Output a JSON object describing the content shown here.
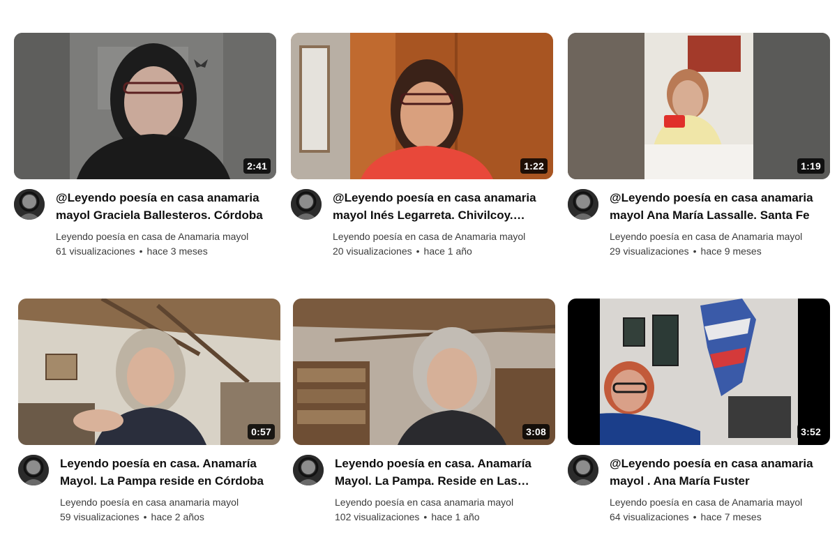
{
  "videos": [
    {
      "duration": "2:41",
      "title": "@Leyendo poesía en casa anamaria mayol Graciela Ballesteros. Córdoba",
      "channel": "Leyendo poesía en casa de Anamaria mayol",
      "views": "61 visualizaciones",
      "age": "hace 3 meses"
    },
    {
      "duration": "1:22",
      "title": "@Leyendo poesía en casa anamaria mayol Inés Legarreta. Chivilcoy. Buenos Aires",
      "channel": "Leyendo poesía en casa de Anamaria mayol",
      "views": "20 visualizaciones",
      "age": "hace 1 año"
    },
    {
      "duration": "1:19",
      "title": "@Leyendo poesía en casa anamaria mayol Ana María Lassalle. Santa Fe",
      "channel": "Leyendo poesía en casa de Anamaria mayol",
      "views": "29 visualizaciones",
      "age": "hace 9 meses"
    },
    {
      "duration": "0:57",
      "title": "Leyendo poesía en casa. Anamaría Mayol. La Pampa reside en Córdoba",
      "channel": "Leyendo poesía en casa anamaria mayol",
      "views": "59 visualizaciones",
      "age": "hace 2 años"
    },
    {
      "duration": "3:08",
      "title": "Leyendo poesía en casa. Anamaría Mayol. La Pampa. Reside en Las Sierras",
      "channel": "Leyendo poesía en casa anamaria mayol",
      "views": "102 visualizaciones",
      "age": "hace 1 año"
    },
    {
      "duration": "3:52",
      "title": "@Leyendo poesía en casa anamaria mayol . Ana María Fuster",
      "channel": "Leyendo poesía en casa de Anamaria mayol",
      "views": "64 visualizaciones",
      "age": "hace 7 meses"
    }
  ],
  "separator": "•",
  "colors": {
    "title": "#0f0f0f",
    "meta": "#3c3c3c",
    "duration_bg": "#000000"
  }
}
